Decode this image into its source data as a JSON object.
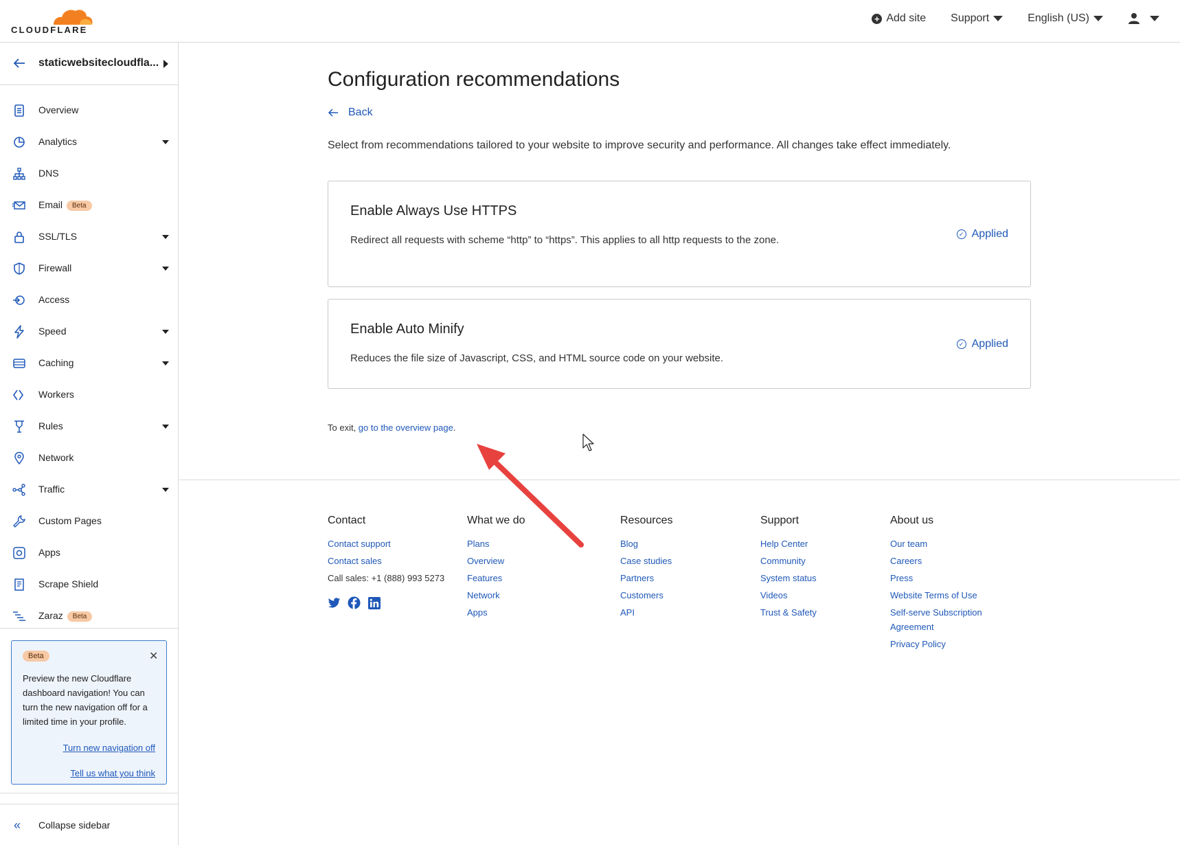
{
  "topbar": {
    "brand": "CLOUDFLARE",
    "add_site": "Add site",
    "support": "Support",
    "language": "English (US)"
  },
  "sidebar": {
    "zone_name": "staticwebsitecloudfla...",
    "items": [
      {
        "label": "Overview",
        "icon": "document-icon"
      },
      {
        "label": "Analytics",
        "icon": "pie-chart-icon"
      },
      {
        "label": "DNS",
        "icon": "network-tree-icon"
      },
      {
        "label": "Email",
        "icon": "envelope-icon",
        "badge": "Beta"
      },
      {
        "label": "SSL/TLS",
        "icon": "lock-icon"
      },
      {
        "label": "Firewall",
        "icon": "shield-icon"
      },
      {
        "label": "Access",
        "icon": "access-icon"
      },
      {
        "label": "Speed",
        "icon": "lightning-icon"
      },
      {
        "label": "Caching",
        "icon": "storage-icon"
      },
      {
        "label": "Workers",
        "icon": "workers-icon"
      },
      {
        "label": "Rules",
        "icon": "rules-icon"
      },
      {
        "label": "Network",
        "icon": "location-pin-icon"
      },
      {
        "label": "Traffic",
        "icon": "traffic-icon"
      },
      {
        "label": "Custom Pages",
        "icon": "wrench-icon"
      },
      {
        "label": "Apps",
        "icon": "apps-icon"
      },
      {
        "label": "Scrape Shield",
        "icon": "scrape-shield-icon"
      },
      {
        "label": "Zaraz",
        "icon": "zaraz-icon",
        "badge": "Beta"
      }
    ],
    "beta_card": {
      "badge": "Beta",
      "message": "Preview the new Cloudflare dashboard navigation! You can turn the new navigation off for a limited time in your profile.",
      "link_off": "Turn new navigation off",
      "link_feedback": "Tell us what you think"
    },
    "collapse": "Collapse sidebar"
  },
  "main": {
    "title": "Configuration recommendations",
    "back": "Back",
    "description": "Select from recommendations tailored to your website to improve security and performance. All changes take effect immediately.",
    "cards": [
      {
        "title": "Enable Always Use HTTPS",
        "text": "Redirect all requests with scheme “http” to “https”. This applies to all http requests to the zone.",
        "status": "Applied"
      },
      {
        "title": "Enable Auto Minify",
        "text": "Reduces the file size of Javascript, CSS, and HTML source code on your website.",
        "status": "Applied"
      }
    ],
    "exit_prefix": "To exit, ",
    "exit_link": "go to the overview page",
    "exit_suffix": "."
  },
  "footer": {
    "contact": {
      "heading": "Contact",
      "links": [
        "Contact support",
        "Contact sales"
      ],
      "call": "Call sales: +1 (888) 993 5273"
    },
    "what_we_do": {
      "heading": "What we do",
      "links": [
        "Plans",
        "Overview",
        "Features",
        "Network",
        "Apps"
      ]
    },
    "resources": {
      "heading": "Resources",
      "links": [
        "Blog",
        "Case studies",
        "Partners",
        "Customers",
        "API"
      ]
    },
    "support": {
      "heading": "Support",
      "links": [
        "Help Center",
        "Community",
        "System status",
        "Videos",
        "Trust & Safety"
      ]
    },
    "about": {
      "heading": "About us",
      "links": [
        "Our team",
        "Careers",
        "Press",
        "Website Terms of Use",
        "Self-serve Subscription",
        "Agreement",
        "Privacy Policy"
      ]
    }
  },
  "colors": {
    "link": "#1f58b8",
    "brand_orange": "#f38020",
    "annotation_arrow": "#e8423f"
  }
}
